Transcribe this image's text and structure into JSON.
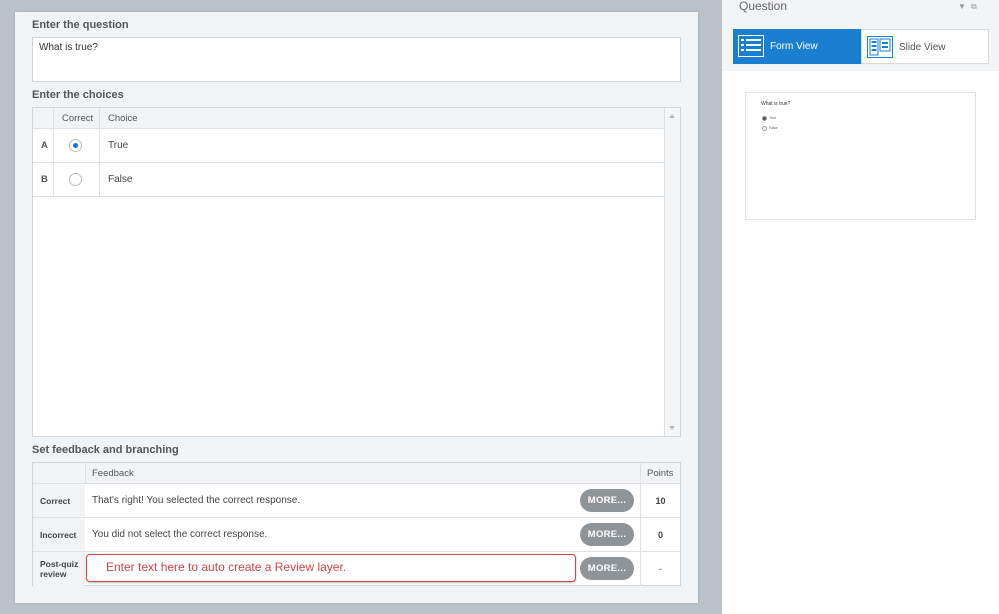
{
  "question_section": {
    "title": "Enter the question",
    "value": "What is true?"
  },
  "choices_section": {
    "title": "Enter the choices",
    "headers": {
      "correct": "Correct",
      "choice": "Choice"
    },
    "rows": [
      {
        "letter": "A",
        "text": "True",
        "correct": true
      },
      {
        "letter": "B",
        "text": "False",
        "correct": false
      }
    ]
  },
  "feedback_section": {
    "title": "Set feedback and branching",
    "headers": {
      "feedback": "Feedback",
      "points": "Points"
    },
    "rows": [
      {
        "label": "Correct",
        "text": "That's right!  You selected the correct response.",
        "more": "MORE...",
        "points": "10"
      },
      {
        "label": "Incorrect",
        "text": "You did not select the correct response.",
        "more": "MORE...",
        "points": "0"
      },
      {
        "label": "Post-quiz review",
        "placeholder": "Enter text here to auto create a Review layer.",
        "more": "MORE...",
        "points": "-"
      }
    ]
  },
  "props_panel": {
    "title": "Question",
    "controls": {
      "collapse": "▼",
      "popout": "⧉"
    },
    "views": {
      "form": "Form View",
      "slide": "Slide View"
    },
    "active_view": "form",
    "preview": {
      "question": "What is true?",
      "choices": [
        "True",
        "False"
      ]
    }
  },
  "colors": {
    "accent": "#1a7fd0",
    "review_highlight": "#d04444",
    "more_button": "#8f9498"
  }
}
